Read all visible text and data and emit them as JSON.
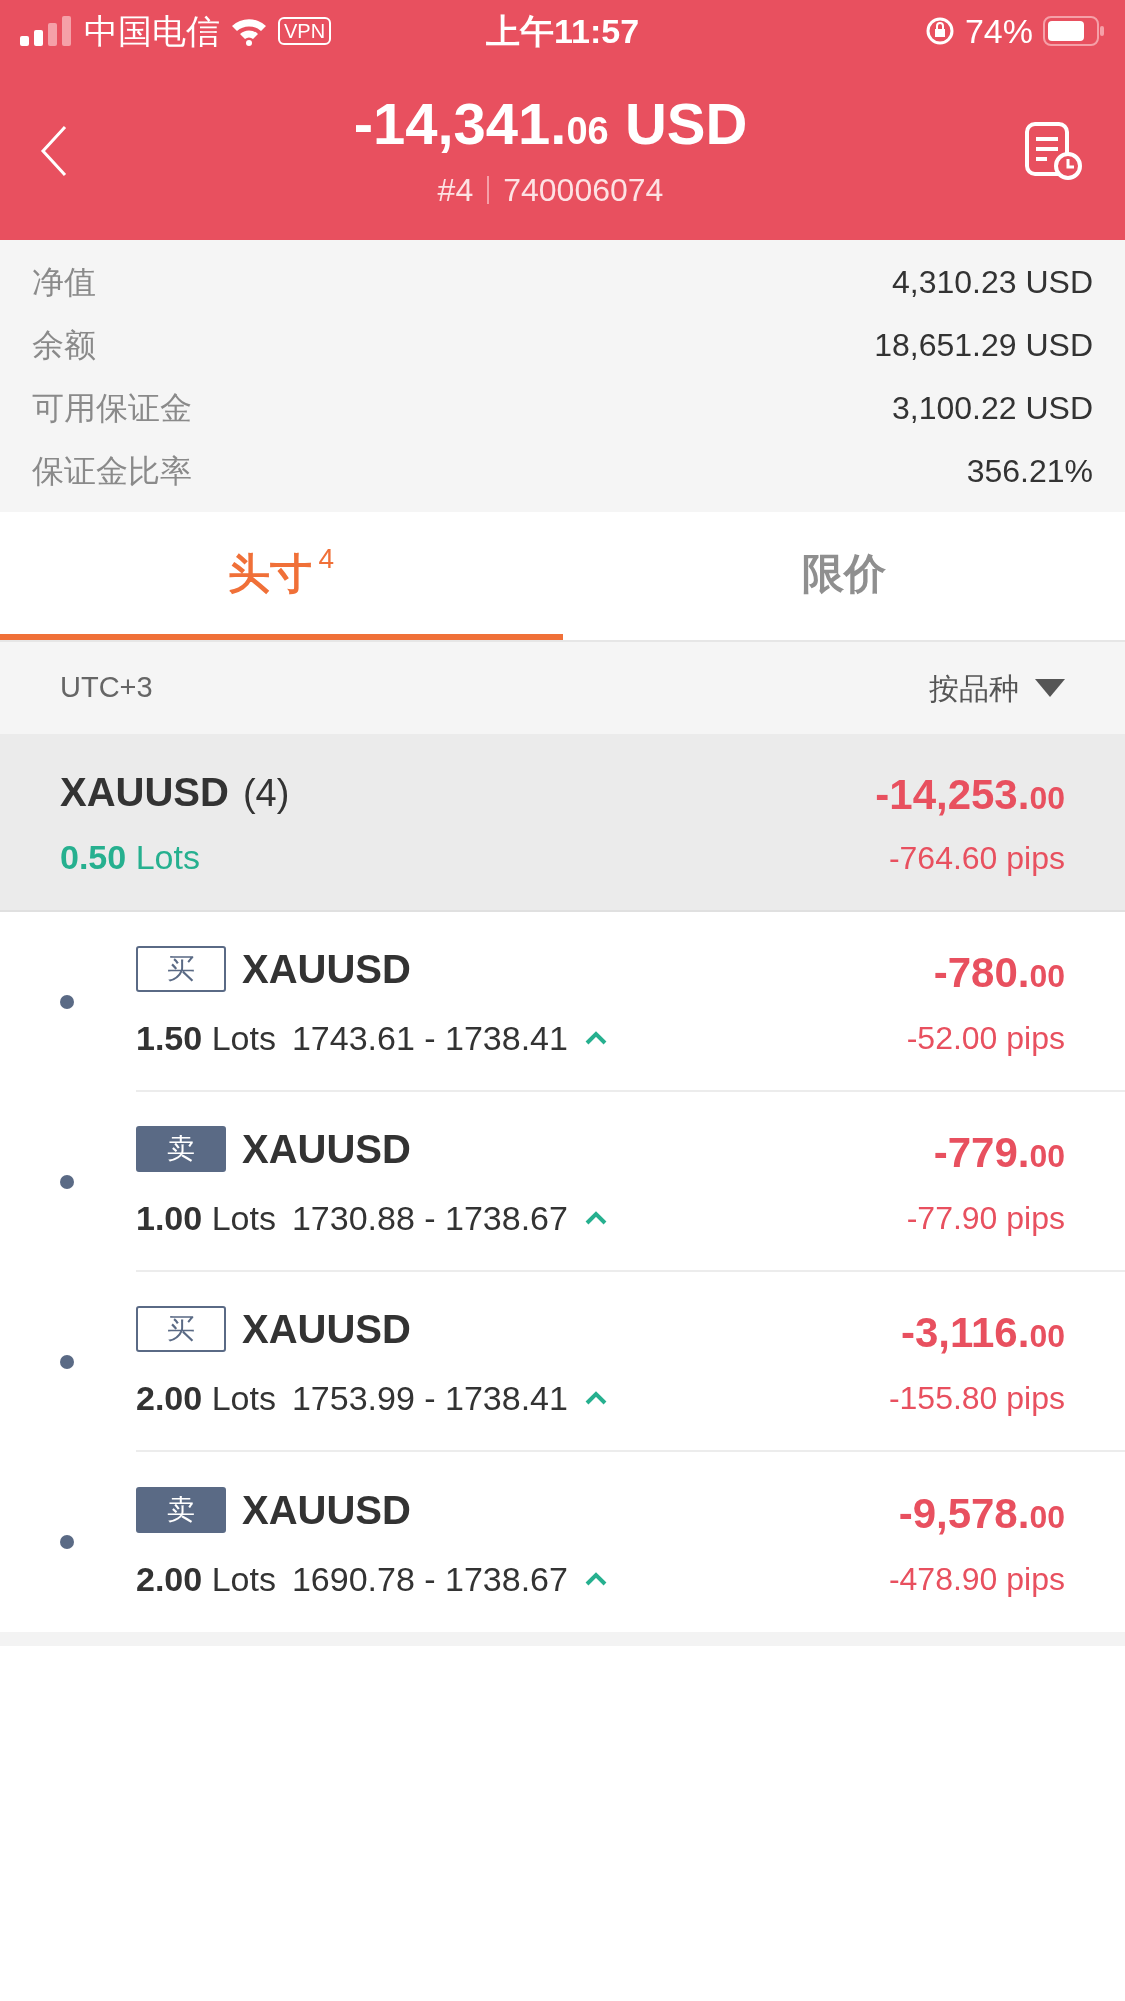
{
  "status_bar": {
    "carrier": "中国电信",
    "vpn": "VPN",
    "time": "上午11:57",
    "battery": "74%"
  },
  "header": {
    "amount": "-14,341.",
    "amount_cents": "06",
    "currency": "USD",
    "account_no": "#4",
    "account_id": "740006074"
  },
  "summary": [
    {
      "label": "净值",
      "value": "4,310.23 USD"
    },
    {
      "label": "余额",
      "value": "18,651.29 USD"
    },
    {
      "label": "可用保证金",
      "value": "3,100.22 USD"
    },
    {
      "label": "保证金比率",
      "value": "356.21%"
    }
  ],
  "tabs": [
    {
      "label": "头寸",
      "count": "4",
      "selected": true
    },
    {
      "label": "限价",
      "selected": false
    }
  ],
  "filter": {
    "timezone": "UTC+3",
    "sort": "按品种"
  },
  "group": {
    "symbol": "XAUUSD",
    "count": "(4)",
    "lots": "0.50",
    "lots_unit": "Lots",
    "profit": "-14,253.",
    "profit_cents": "00",
    "pips": "-764.60 pips"
  },
  "positions": [
    {
      "kind": "buy",
      "side": "买",
      "symbol": "XAUUSD",
      "lots": "1.50",
      "lots_unit": "Lots",
      "prices": "1743.61 - 1738.41",
      "profit": "-780.",
      "profit_cents": "00",
      "pips": "-52.00 pips"
    },
    {
      "kind": "sell",
      "side": "卖",
      "symbol": "XAUUSD",
      "lots": "1.00",
      "lots_unit": "Lots",
      "prices": "1730.88 - 1738.67",
      "profit": "-779.",
      "profit_cents": "00",
      "pips": "-77.90 pips"
    },
    {
      "kind": "buy",
      "side": "买",
      "symbol": "XAUUSD",
      "lots": "2.00",
      "lots_unit": "Lots",
      "prices": "1753.99 - 1738.41",
      "profit": "-3,116.",
      "profit_cents": "00",
      "pips": "-155.80 pips"
    },
    {
      "kind": "sell",
      "side": "卖",
      "symbol": "XAUUSD",
      "lots": "2.00",
      "lots_unit": "Lots",
      "prices": "1690.78 - 1738.67",
      "profit": "-9,578.",
      "profit_cents": "00",
      "pips": "-478.90 pips"
    }
  ]
}
